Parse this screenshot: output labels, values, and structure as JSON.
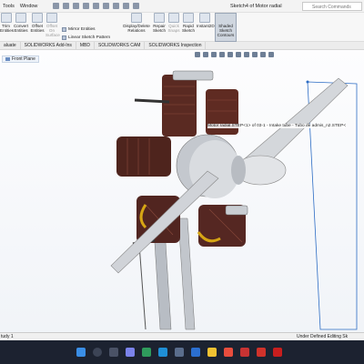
{
  "menu": {
    "items": [
      "Tools",
      "Window"
    ]
  },
  "window_title": "Sketch4 of Motor radial",
  "search": {
    "placeholder": "Search Commands"
  },
  "ribbon": {
    "buttons": [
      {
        "label": "Trim Entities"
      },
      {
        "label": "Convert Entities"
      },
      {
        "label": "Offset Entities"
      },
      {
        "label": "Offset On Surface"
      },
      {
        "label": "Display/Delete Relations"
      },
      {
        "label": "Repair Sketch"
      },
      {
        "label": "Quick Snaps"
      },
      {
        "label": "Rapid Sketch"
      },
      {
        "label": "Instant2D"
      }
    ],
    "small": [
      "Mirror Entities",
      "Linear Sketch Pattern",
      "Move Entities"
    ],
    "shaded": "Shaded Sketch Contours"
  },
  "tabs": [
    "aluate",
    "SOLIDWORKS Add-Ins",
    "MBD",
    "SOLIDWORKS CAM",
    "SOLIDWORKS Inspection"
  ],
  "tree": {
    "plane_label": "Front Plane"
  },
  "tooltip": "Motor radial.STEP<1> of 03-1 - Intake tube - Tubo de admis_n2.STEP<",
  "status": {
    "left": "tudy 1",
    "right": "Under Defined   Editing Sk"
  },
  "colors": {
    "accent": "#2c6cc4",
    "taskbar": "#1c2230",
    "cylinder": "#5a2a22",
    "metal": "#c9cdd2"
  }
}
